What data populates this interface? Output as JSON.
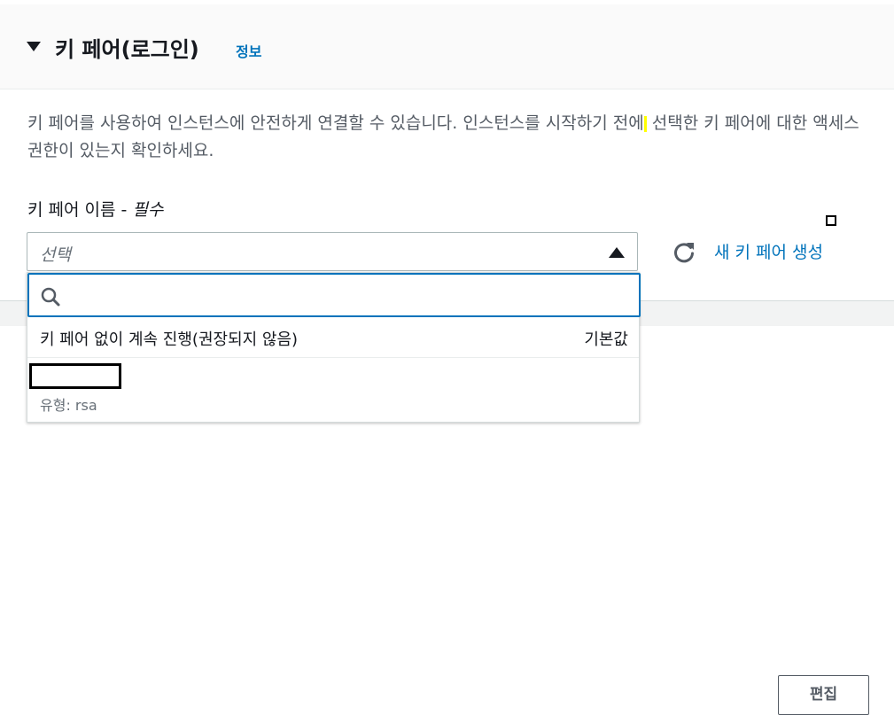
{
  "section": {
    "title": "키 페어(로그인)",
    "info_link": "정보",
    "description_before": "키 페어를 사용하여 인스턴스에 안전하게 연결할 수 있습니다. 인스턴스를 시작하기 전에",
    "description_after": " 선택한 키 페어에 대한 액세스 권한이 있는지 확인하세요.",
    "field_label": "키 페어 이름 - ",
    "field_required": "필수",
    "select_placeholder": "선택",
    "create_link": "새 키 페어 생성"
  },
  "dropdown": {
    "search_placeholder": "",
    "options": [
      {
        "label": "키 페어 없이 계속 진행(권장되지 않음)",
        "tag": "기본값"
      },
      {
        "label": "",
        "description": "유형: rsa"
      }
    ]
  },
  "panel": {
    "edit_button": "편집"
  },
  "icons": {
    "caret": "caret-down-icon",
    "select_caret": "caret-up-icon",
    "refresh": "refresh-icon",
    "search": "search-icon"
  },
  "colors": {
    "link": "#0073bb",
    "focus_border": "#0073bb",
    "text": "#16191f",
    "muted": "#545b64"
  }
}
